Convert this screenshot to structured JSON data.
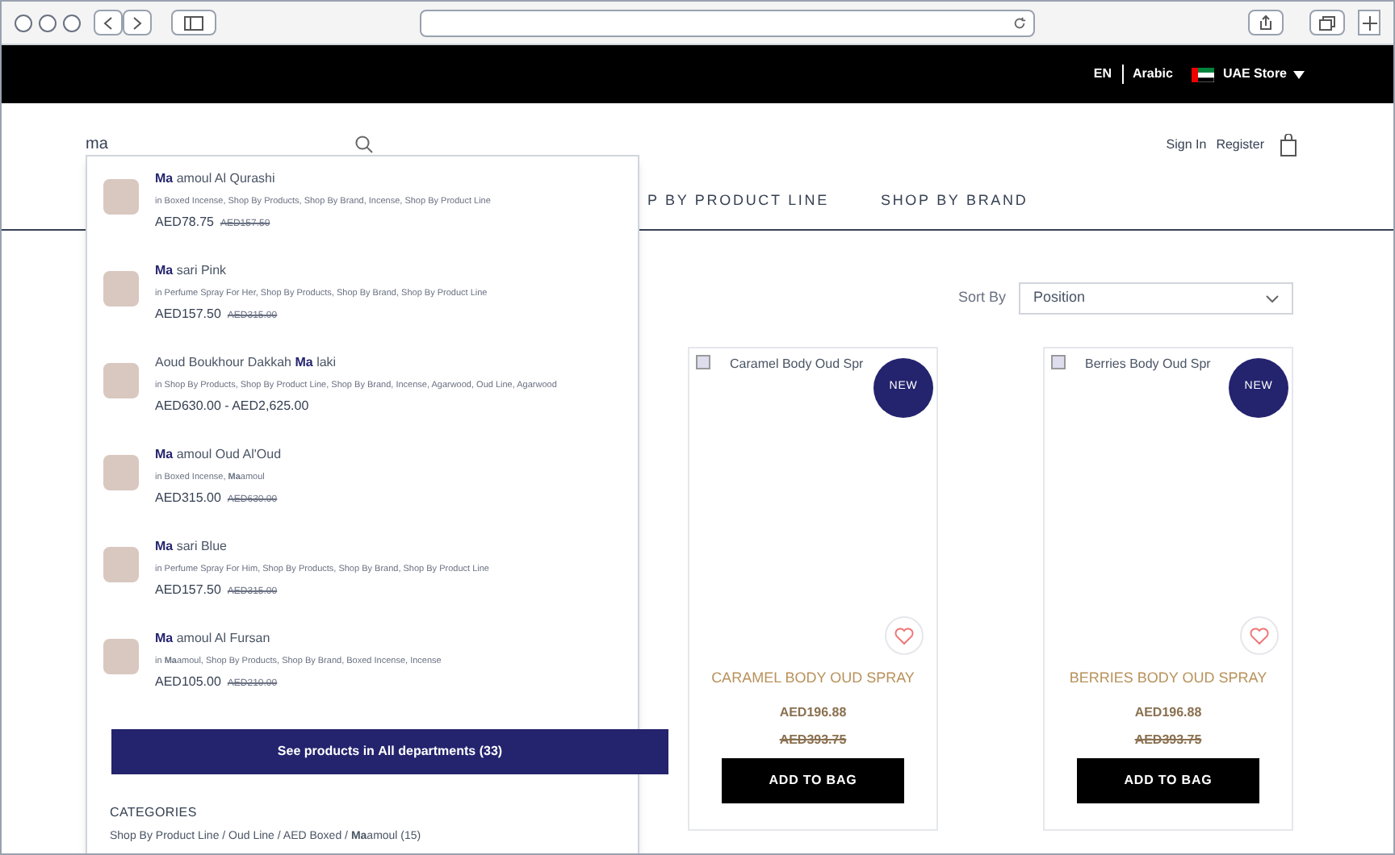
{
  "top_bar": {
    "language": "EN",
    "alt_language": "Arabic",
    "store": "UAE Store"
  },
  "header": {
    "search": {
      "value": "ma"
    },
    "links": [
      "Sign In",
      "Register"
    ]
  },
  "nav": [
    "P BY PRODUCT LINE",
    "SHOP BY BRAND"
  ],
  "suggestions": [
    {
      "match": "Ma",
      "after": " amoul Al Qurashi",
      "categories": "in Boxed Incense, Shop By Products, Shop By Brand, Incense, Shop By Product Line",
      "price": "AED78.75",
      "old_price": "AED157.50"
    },
    {
      "match": "Ma",
      "after": " sari Pink",
      "categories": "in Perfume Spray For Her, Shop By Products, Shop By Brand, Shop By Product Line",
      "price": "AED157.50",
      "old_price": "AED315.00"
    },
    {
      "before": "Aoud Boukhour Dakkah ",
      "match": "Ma",
      "after": " laki",
      "categories": "in Shop By Products, Shop By Product Line, Shop By Brand, Incense, Agarwood, Oud Line, Agarwood",
      "price": "AED630.00 - AED2,625.00"
    },
    {
      "match": "Ma",
      "after": " amoul Oud Al'Oud",
      "categories": "in Boxed Incense, **Ma**amoul",
      "price": "AED315.00",
      "old_price": "AED630.00"
    },
    {
      "match": "Ma",
      "after": " sari Blue",
      "categories": "in Perfume Spray For Him, Shop By Products, Shop By Brand, Shop By Product Line",
      "price": "AED157.50",
      "old_price": "AED315.00"
    },
    {
      "match": "Ma",
      "after": " amoul Al Fursan",
      "categories": "in **Ma**amoul, Shop By Products, Shop By Brand, Boxed Incense, Incense",
      "price": "AED105.00",
      "old_price": "AED210.00"
    }
  ],
  "see_all": "See products in **All departments** (33)",
  "categories": {
    "title": "CATEGORIES",
    "items": [
      "Shop By Product Line / Oud Line / AED Boxed / **Ma**amoul (15)"
    ]
  },
  "sort": {
    "label": "Sort By",
    "value": "Position"
  },
  "products": [
    {
      "image_alt": "Caramel Body Oud Spr",
      "badge": "NEW",
      "name": "CARAMEL BODY OUD SPRAY",
      "price": "AED196.88",
      "old_price": "AED393.75",
      "button": "ADD TO BAG"
    },
    {
      "image_alt": "Berries Body Oud Spr",
      "badge": "NEW",
      "name": "BERRIES BODY OUD SPRAY",
      "price": "AED196.88",
      "old_price": "AED393.75",
      "button": "ADD TO BAG"
    }
  ]
}
